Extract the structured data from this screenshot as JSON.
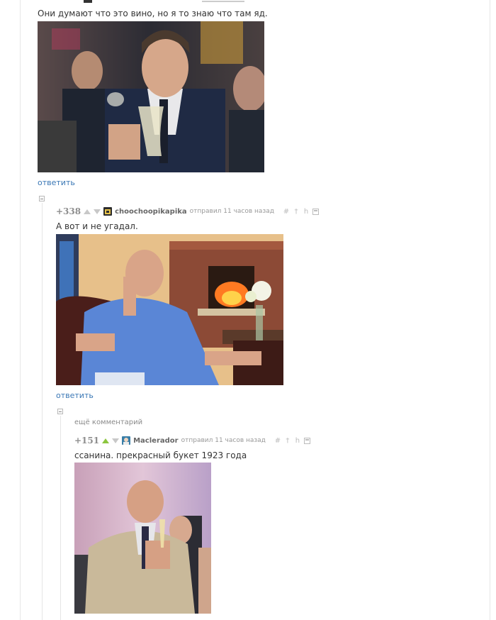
{
  "colors": {
    "link": "#3a77b5",
    "upvote_active": "#8cc63f",
    "meta": "#999999"
  },
  "comments": [
    {
      "text": "Они думают что это вино, но я то знаю что там яд.",
      "reply_label": "ответить"
    },
    {
      "rating": "+338",
      "username": "choochoopikapika",
      "posted": "отправил 11 часов назад",
      "text": "А вот и не угадал.",
      "reply_label": "ответить",
      "tools": [
        "#",
        "†",
        "h"
      ]
    },
    {
      "more_label": "ещё комментарий",
      "rating": "+151",
      "username": "Maclerador",
      "posted": "отправил 11 часов назад",
      "text": "ссанина. прекрасный букет 1923 года",
      "tools": [
        "#",
        "†",
        "h"
      ]
    }
  ]
}
